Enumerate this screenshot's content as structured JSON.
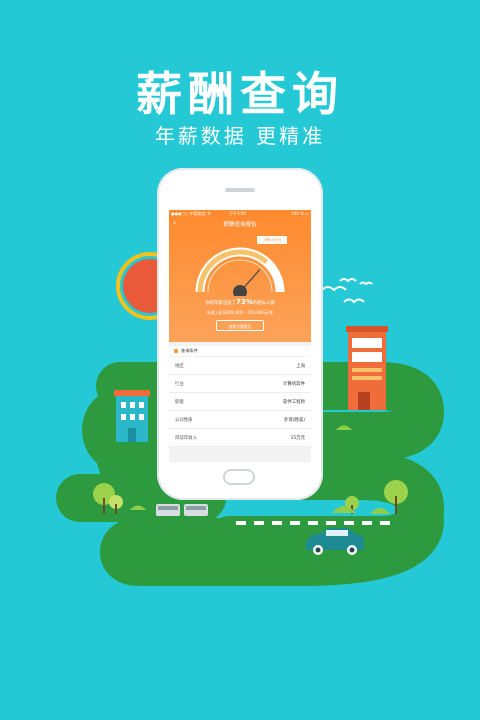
{
  "hero": {
    "title": "薪酬查询",
    "subtitle": "年薪数据 更精准"
  },
  "app": {
    "status_left": "●●●○○ 中国电信 令",
    "status_time": "下午3:09",
    "status_right": "100 % ▭",
    "nav_title": "薪酬查询报告",
    "back_icon": "chevron-left-icon",
    "rank_tag": "上榜10万元",
    "beat_prefix": "你的年薪击败了",
    "beat_value": "73%",
    "beat_suffix": "的相似人群",
    "range_text": "年收入区间200,000 - 200,000元/年",
    "view_all_button": "查看完整报告",
    "conditions_label": "查询条件",
    "conditions": [
      {
        "label": "地区",
        "value": "上海"
      },
      {
        "label": "行业",
        "value": "计算机软件"
      },
      {
        "label": "职能",
        "value": "软件工程师"
      },
      {
        "label": "公司性质",
        "value": "外资(欧美)"
      },
      {
        "label": "目前年收入",
        "value": "15万元"
      }
    ],
    "gauge_level": 0.73
  },
  "colors": {
    "background": "#24c9d5",
    "accent": "#ff8a2e",
    "grass": "#2e9a3f",
    "sun": "#f4c21a"
  }
}
